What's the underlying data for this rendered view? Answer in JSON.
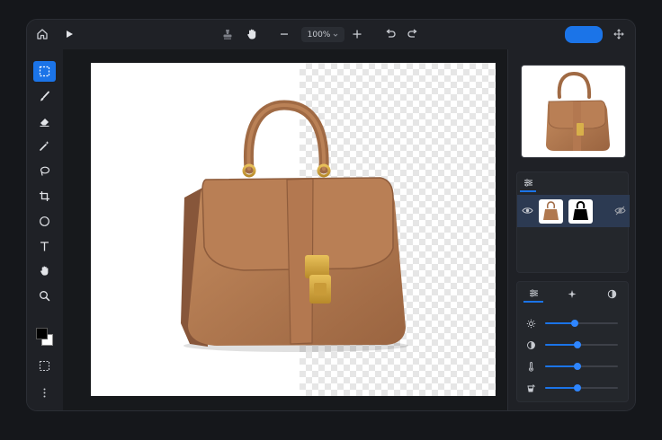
{
  "topbar": {
    "zoom_value": "100%",
    "icons": [
      "home-icon",
      "play-icon",
      "stamp-icon",
      "hand-icon",
      "zoom-out-icon",
      "zoom-in-icon",
      "undo-icon",
      "redo-icon",
      "move-icon"
    ]
  },
  "toolbar": {
    "tools": [
      "marquee-select",
      "brush",
      "eraser",
      "magic-wand",
      "lasso",
      "crop",
      "ellipse",
      "text",
      "hand",
      "zoom"
    ],
    "active_tool": "marquee-select",
    "foreground_color": "#000000",
    "background_color": "#ffffff"
  },
  "colors": {
    "accent": "#1b74e8",
    "panel": "#1f2126",
    "canvas_bg": "#17191c",
    "selected_layer": "#2c3a52",
    "bag_leather": "#b0784f",
    "bag_hardware": "#d4a63a"
  },
  "layers": {
    "items": [
      {
        "visible": true,
        "has_mask": true,
        "mask_visible": false
      }
    ]
  },
  "adjustments": {
    "tabs": [
      "sliders-tab",
      "sparkle-tab",
      "contrast-tab"
    ],
    "active_tab": "sliders-tab",
    "sliders": [
      {
        "icon": "brightness-icon",
        "value": 0.41
      },
      {
        "icon": "contrast-icon",
        "value": 0.44
      },
      {
        "icon": "temperature-icon",
        "value": 0.44
      },
      {
        "icon": "saturation-icon",
        "value": 0.44
      }
    ]
  }
}
